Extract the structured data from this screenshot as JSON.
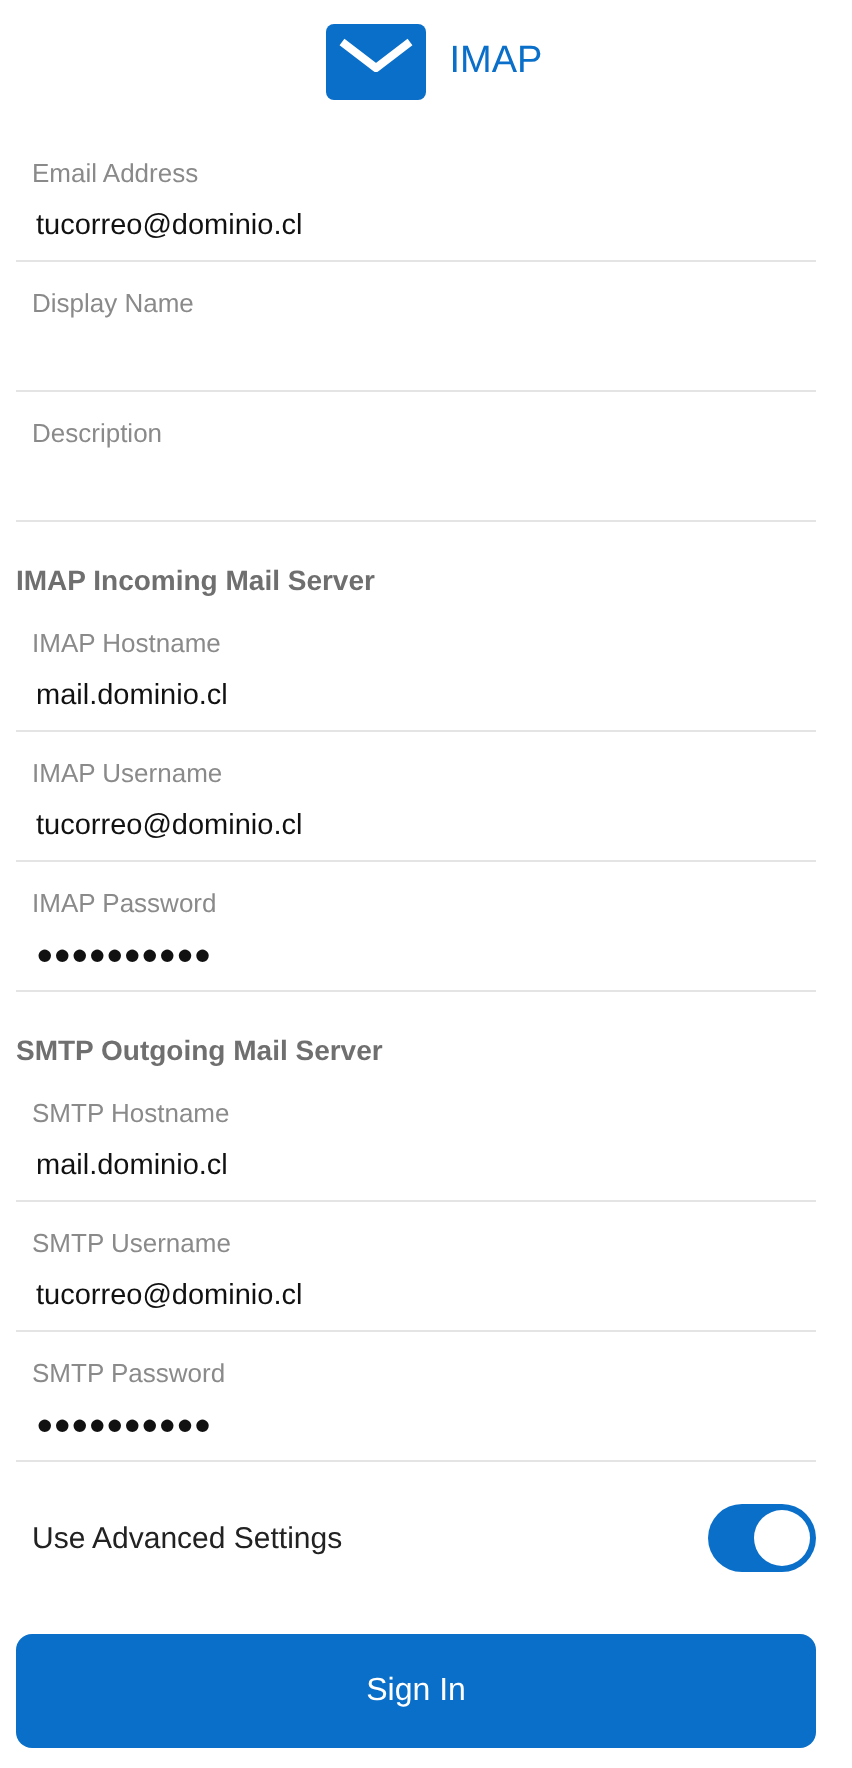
{
  "header": {
    "title": "IMAP"
  },
  "account_fields": [
    {
      "label": "Email Address",
      "value": "tucorreo@dominio.cl"
    },
    {
      "label": "Display Name"
    },
    {
      "label": "Description"
    }
  ],
  "sections": [
    {
      "title": "IMAP Incoming Mail Server",
      "fields": [
        {
          "label": "IMAP Hostname",
          "value": "mail.dominio.cl"
        },
        {
          "label": "IMAP Username",
          "value": "tucorreo@dominio.cl"
        },
        {
          "label": "IMAP Password",
          "value": "●●●●●●●●●●"
        }
      ]
    },
    {
      "title": "SMTP Outgoing Mail Server",
      "fields": [
        {
          "label": "SMTP Hostname",
          "value": "mail.dominio.cl"
        },
        {
          "label": "SMTP Username",
          "value": "tucorreo@dominio.cl"
        },
        {
          "label": "SMTP Password",
          "value": "●●●●●●●●●●"
        }
      ]
    }
  ],
  "advanced": {
    "label": "Use Advanced Settings",
    "on": true
  },
  "sign_in_button": "Sign In"
}
